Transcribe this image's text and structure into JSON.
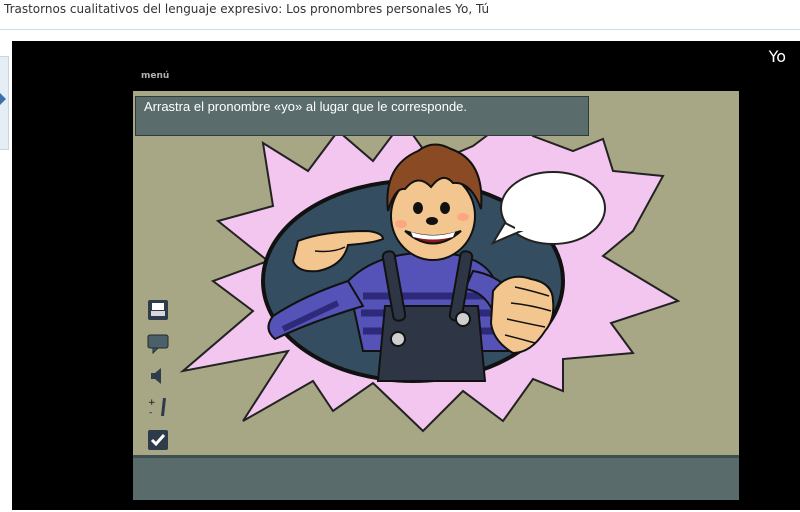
{
  "page": {
    "title": "Trastornos cualitativos del lenguaje expresivo: Los pronombres personales Yo, Tú"
  },
  "player": {
    "slide_title": "Yo",
    "menu_label": "menú",
    "instruction": "Arrastra el pronombre «yo» al lugar que le corresponde."
  },
  "toolbar": {
    "items": [
      {
        "icon": "print-icon"
      },
      {
        "icon": "speech-bubble-icon"
      },
      {
        "icon": "speaker-icon"
      },
      {
        "icon": "volume-adjust-icon"
      },
      {
        "icon": "check-icon"
      }
    ]
  },
  "colors": {
    "stage_bg": "#a7a685",
    "panel": "#5b6c6c",
    "burst": "#f3c6ef",
    "shirt_blue": "#5553b7",
    "overalls": "#2e3645",
    "hair": "#8a4b24",
    "skin": "#f4c68f"
  }
}
